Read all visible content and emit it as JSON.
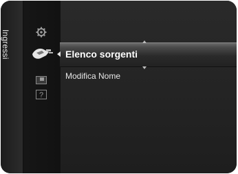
{
  "sidebar": {
    "tab_label": "Ingressi",
    "icons": [
      "settings-icon",
      "input-icon",
      "pip-icon",
      "help-icon"
    ],
    "active_icon": "input-icon"
  },
  "menu": {
    "items": [
      {
        "label": "Elenco sorgenti",
        "selected": true
      },
      {
        "label": "Modifica Nome",
        "selected": false
      }
    ]
  },
  "colors": {
    "background": "#222222",
    "selected_text": "#ffffff",
    "text": "#e8e8e8"
  }
}
